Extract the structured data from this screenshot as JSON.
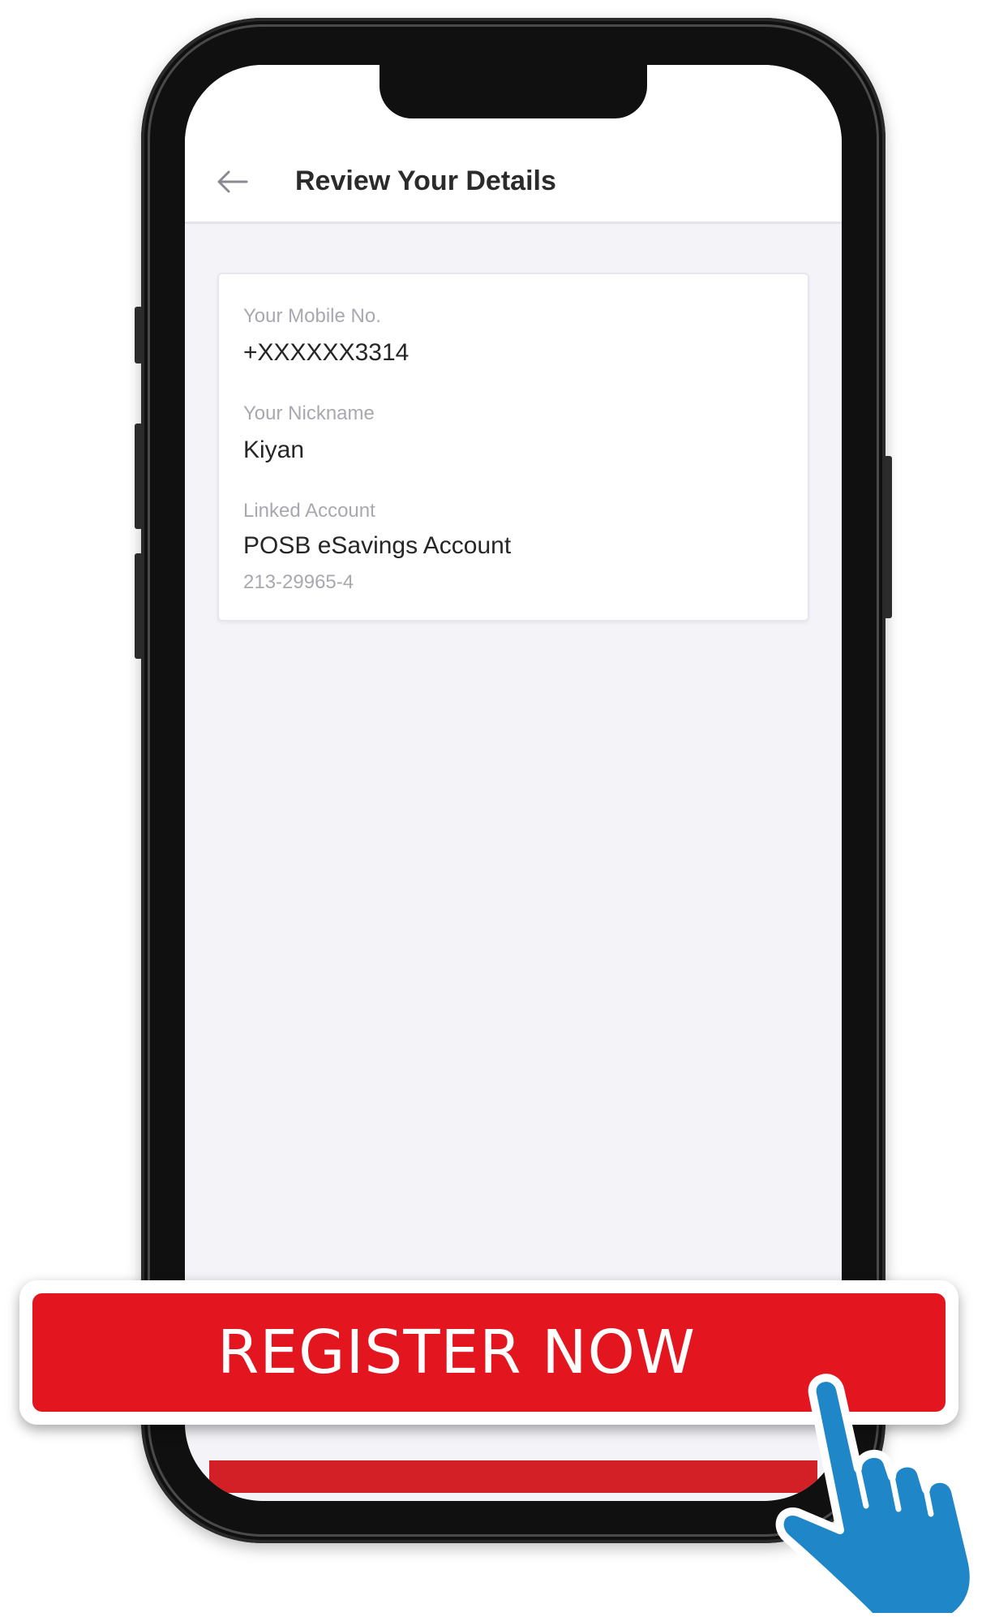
{
  "header": {
    "title": "Review Your Details",
    "back_icon": "arrow-left-icon"
  },
  "details": {
    "mobile_label": "Your Mobile No.",
    "mobile_value": "+XXXXXX3314",
    "nickname_label": "Your Nickname",
    "nickname_value": "Kiyan",
    "account_label": "Linked Account",
    "account_value": "POSB eSavings Account",
    "account_number": "213-29965-4"
  },
  "cta": {
    "label": "REGISTER NOW",
    "icon": "pointing-hand-icon"
  },
  "colors": {
    "brand_red": "#e3161f",
    "hand_blue": "#1f86c8"
  }
}
